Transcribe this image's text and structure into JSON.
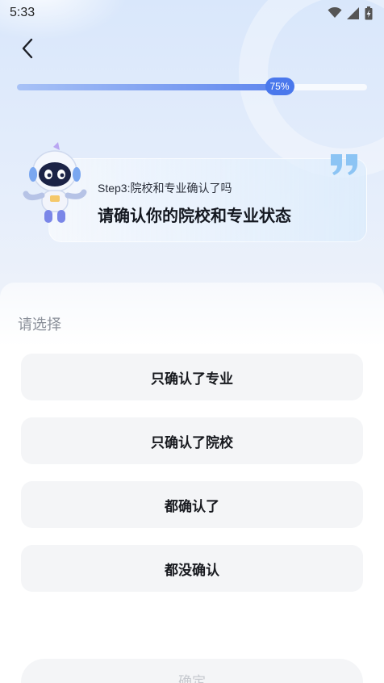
{
  "status_bar": {
    "time": "5:33"
  },
  "progress": {
    "label": "75%",
    "value": 0.75
  },
  "prompt": {
    "step": "Step3:院校和专业确认了吗",
    "headline": "请确认你的院校和专业状态"
  },
  "sheet": {
    "label": "请选择",
    "options": [
      {
        "label": "只确认了专业"
      },
      {
        "label": "只确认了院校"
      },
      {
        "label": "都确认了"
      },
      {
        "label": "都没确认"
      }
    ],
    "confirm_label": "确定"
  },
  "colors": {
    "accent": "#4a78ec",
    "option_bg": "#f4f5f7",
    "disabled_text": "#c6c9cf"
  },
  "icons": [
    "back-arrow-icon",
    "wifi-icon",
    "cellular-signal-icon",
    "battery-charging-icon",
    "quote-icon"
  ]
}
